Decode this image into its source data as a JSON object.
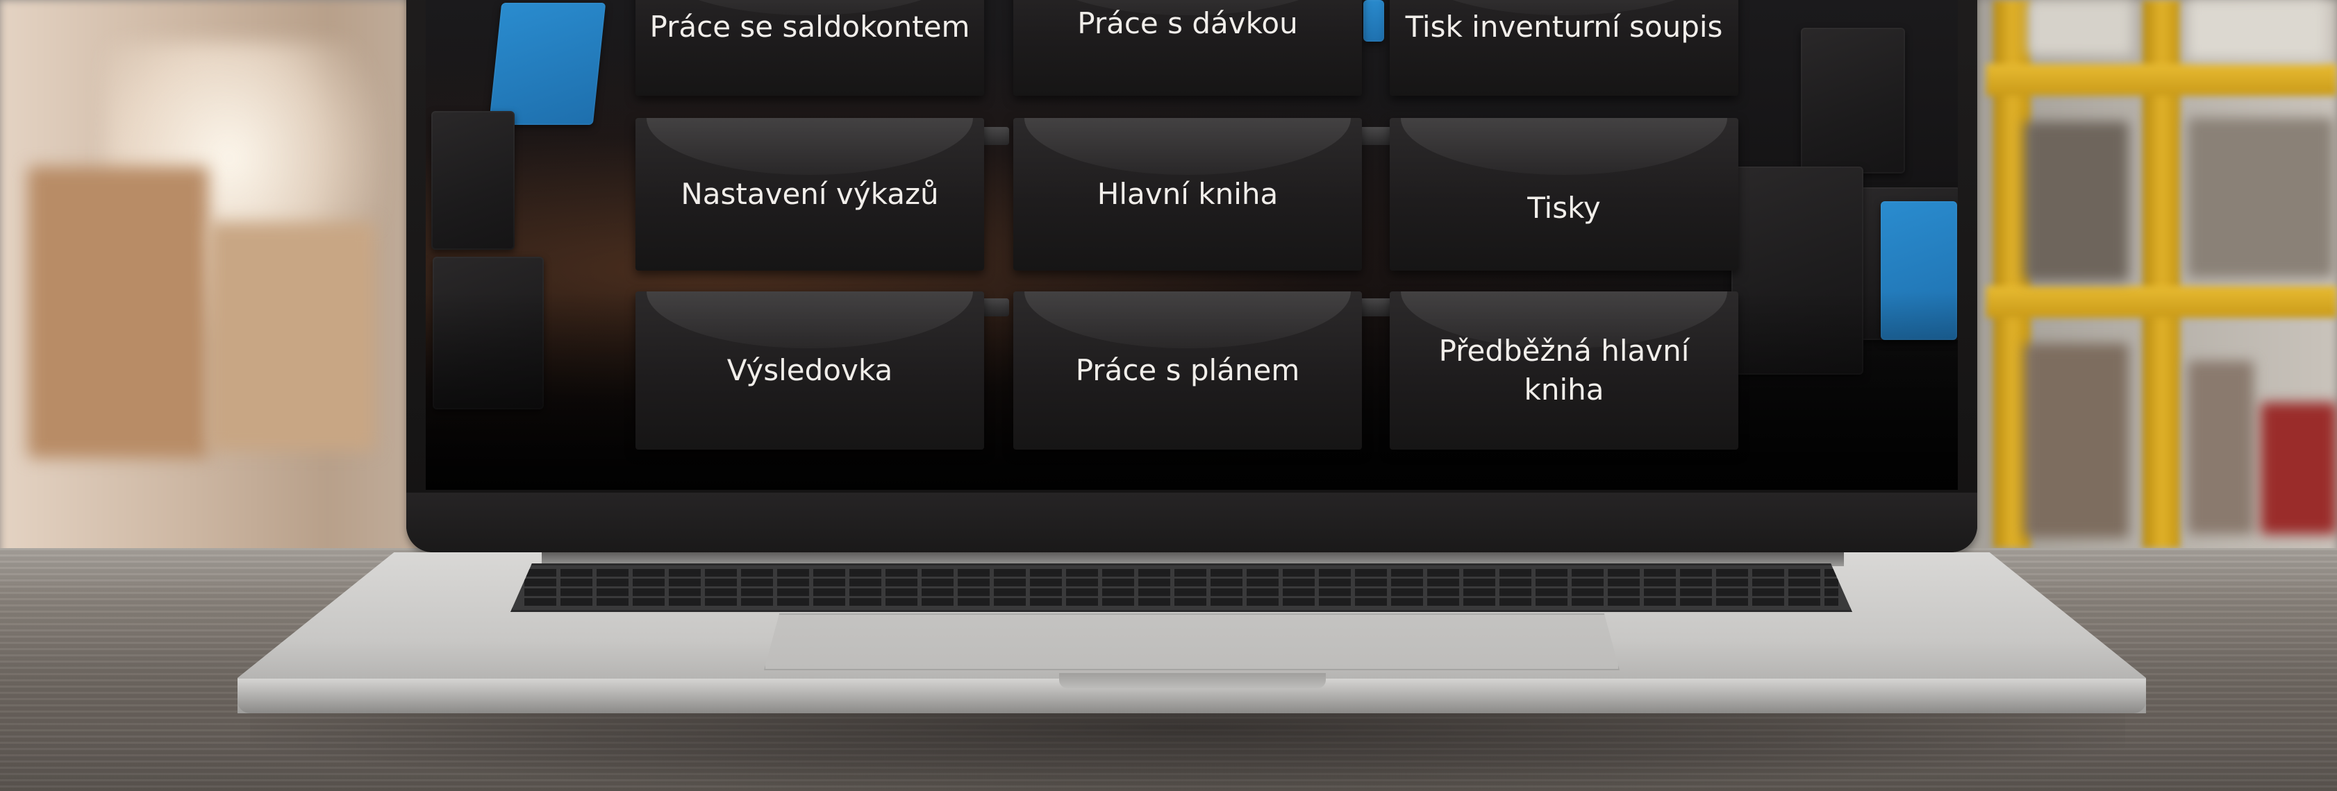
{
  "menu": {
    "tiles": [
      {
        "label": "Práce se saldokontem"
      },
      {
        "label": "Práce s dávkou"
      },
      {
        "label": "Tisk inventurní soupis"
      },
      {
        "label": "Nastavení výkazů"
      },
      {
        "label": "Hlavní kniha"
      },
      {
        "label": "Tisky"
      },
      {
        "label": "Výsledovka"
      },
      {
        "label": "Práce s plánem"
      },
      {
        "label": "Předběžná hlavní kniha"
      }
    ]
  },
  "colors": {
    "tile_text": "#f1eeea",
    "tile_background": "#1e1c1d",
    "accent_blue": "#2a8ccf",
    "shelf_yellow": "#e1b22a",
    "laptop_silver": "#c8c7c5"
  }
}
